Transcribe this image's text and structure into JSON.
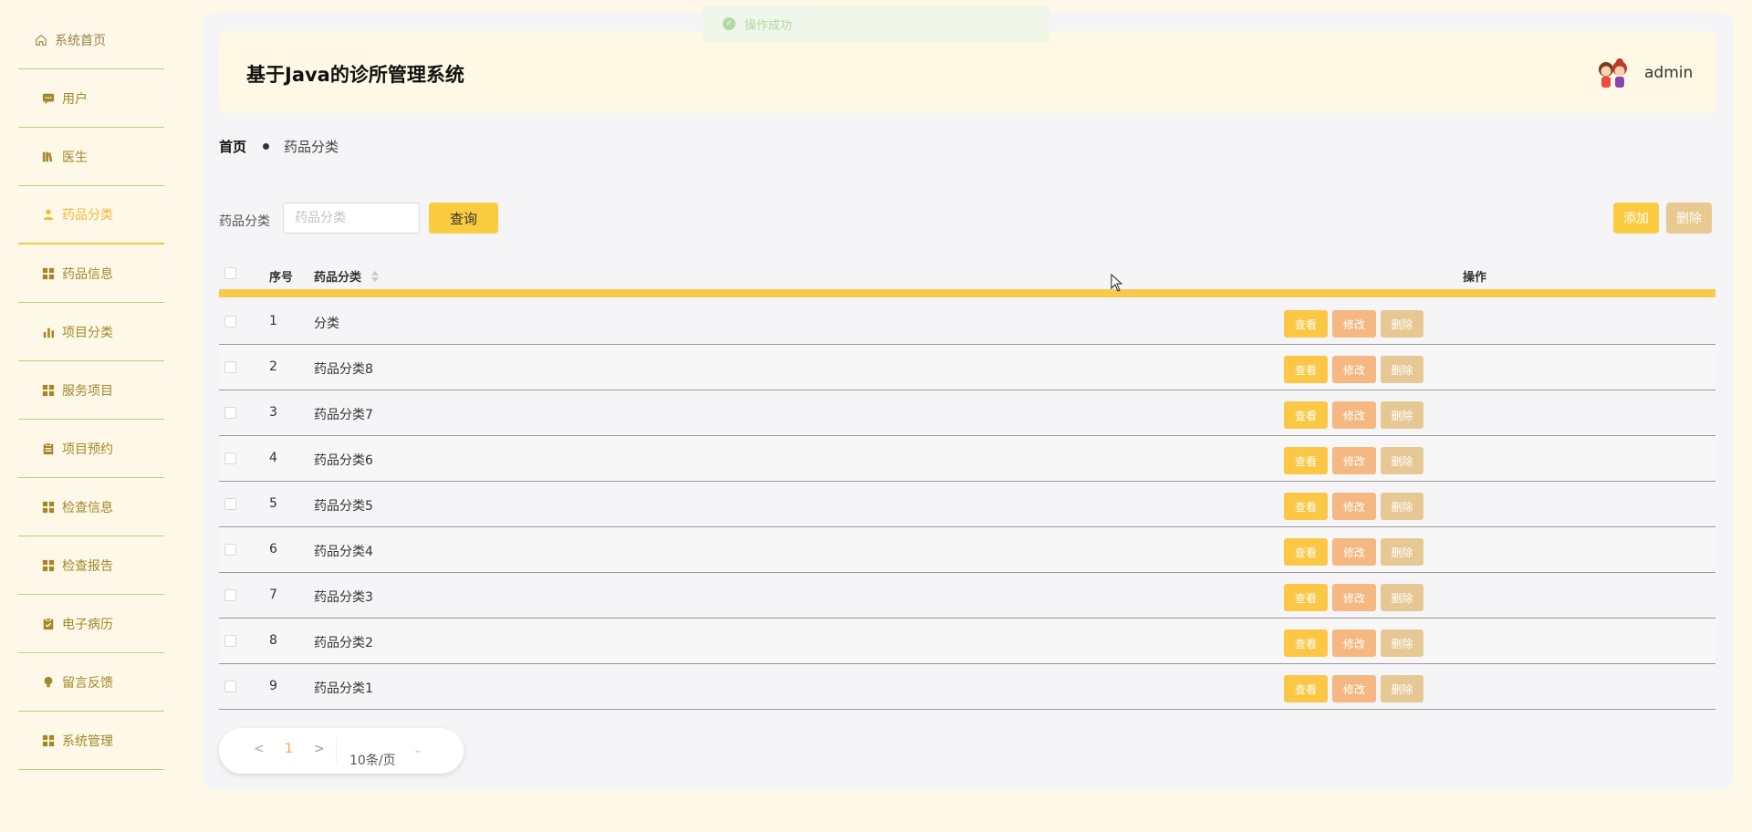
{
  "toast": {
    "message": "操作成功"
  },
  "app": {
    "title": "基于Java的诊所管理系统",
    "username": "admin"
  },
  "sidebar": {
    "items": [
      {
        "label": "系统首页",
        "icon": "home-icon"
      },
      {
        "label": "用户",
        "icon": "chat-icon"
      },
      {
        "label": "医生",
        "icon": "books-icon"
      },
      {
        "label": "药品分类",
        "icon": "person-icon",
        "active": true
      },
      {
        "label": "药品信息",
        "icon": "grid-icon"
      },
      {
        "label": "项目分类",
        "icon": "bar-chart-icon"
      },
      {
        "label": "服务项目",
        "icon": "grid-icon"
      },
      {
        "label": "项目预约",
        "icon": "clipboard-icon"
      },
      {
        "label": "检查信息",
        "icon": "grid-icon"
      },
      {
        "label": "检查报告",
        "icon": "grid-icon"
      },
      {
        "label": "电子病历",
        "icon": "clipboard-check-icon"
      },
      {
        "label": "留言反馈",
        "icon": "bulb-icon"
      },
      {
        "label": "系统管理",
        "icon": "grid-icon"
      }
    ]
  },
  "breadcrumb": {
    "home": "首页",
    "current": "药品分类"
  },
  "search": {
    "label": "药品分类",
    "placeholder": "药品分类",
    "button": "查询"
  },
  "toolbar": {
    "add_label": "添加",
    "delete_label": "删除"
  },
  "table": {
    "columns": [
      "序号",
      "药品分类",
      "操作"
    ],
    "rows": [
      {
        "index": "1",
        "name": "分类"
      },
      {
        "index": "2",
        "name": "药品分类8"
      },
      {
        "index": "3",
        "name": "药品分类7"
      },
      {
        "index": "4",
        "name": "药品分类6"
      },
      {
        "index": "5",
        "name": "药品分类5"
      },
      {
        "index": "6",
        "name": "药品分类4"
      },
      {
        "index": "7",
        "name": "药品分类3"
      },
      {
        "index": "8",
        "name": "药品分类2"
      },
      {
        "index": "9",
        "name": "药品分类1"
      }
    ],
    "actions": {
      "view": "查看",
      "edit": "修改",
      "delete": "删除"
    }
  },
  "pagination": {
    "prev": "<",
    "page": "1",
    "next": ">",
    "page_size": "10条/页"
  },
  "colors": {
    "accent": "#fbcb40",
    "sidebar_text": "#a48729",
    "active": "#f3bb36",
    "edit": "#f5b883",
    "delete": "#e6c895"
  }
}
